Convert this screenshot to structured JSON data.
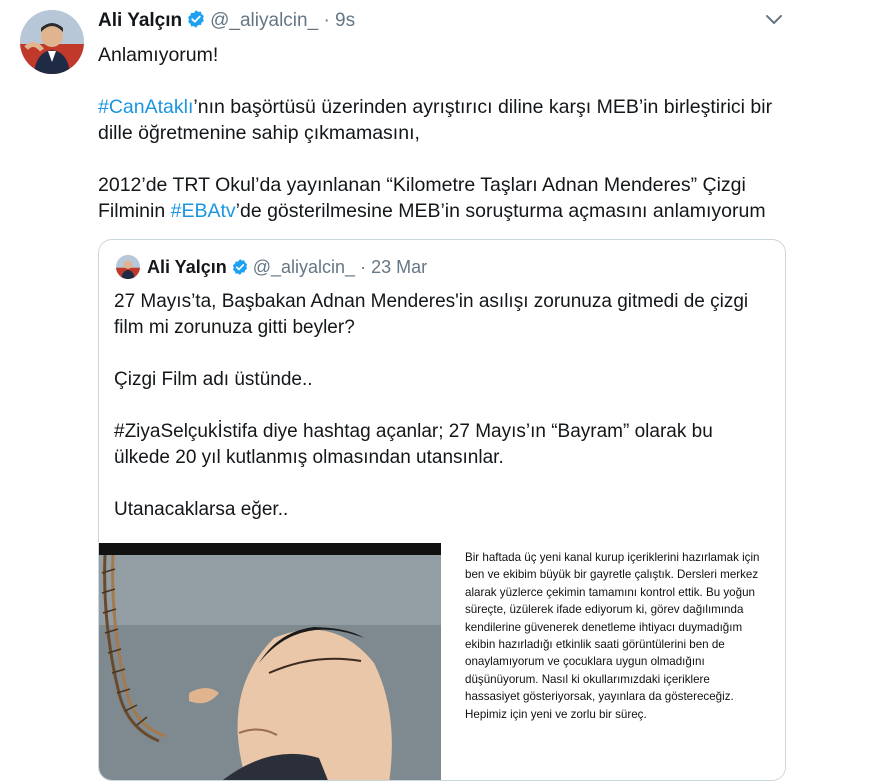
{
  "tweet": {
    "author_name": "Ali Yalçın",
    "author_handle": "@_aliyalcin_",
    "separator": "·",
    "time": "9s",
    "paragraphs": [
      [
        {
          "t": "Anlamıyorum!",
          "h": false
        }
      ],
      [
        {
          "t": "#CanAtaklı",
          "h": true
        },
        {
          "t": "’nın başörtüsü üzerinden ayrıştırıcı diline karşı MEB’in birleştirici bir dille öğretmenine sahip çıkmamasını,",
          "h": false
        }
      ],
      [
        {
          "t": "2012’de TRT Okul’da yayınlanan “Kilometre Taşları Adnan Menderes” Çizgi Filminin ",
          "h": false
        },
        {
          "t": "#EBAtv",
          "h": true
        },
        {
          "t": "’de gösterilmesine MEB’in soruşturma açmasını anlamıyorum",
          "h": false
        }
      ]
    ]
  },
  "quoted": {
    "author_name": "Ali Yalçın",
    "author_handle": "@_aliyalcin_",
    "separator": "·",
    "time": "23 Mar",
    "paragraphs": [
      "27 Mayıs’ta, Başbakan Adnan Menderes'in asılışı zorunuza gitmedi de çizgi film mi zorunuza gitti beyler?",
      "Çizgi Film adı üstünde..",
      "#ZiyaSelçukİstifa diye hashtag açanlar; 27 Mayıs’ın “Bayram” olarak bu ülkede 20 yıl kutlanmış olmasından utansınlar.",
      "Utanacaklarsa eğer.."
    ],
    "statement_text": "Bir haftada üç yeni kanal kurup içeriklerini hazırlamak için ben ve ekibim büyük bir gayretle çalıştık. Dersleri merkez alarak yüzlerce çekimin tamamını kontrol ettik. Bu yoğun süreçte, üzülerek ifade ediyorum ki, görev dağılımında kendilerine güvenerek denetleme ihtiyacı duymadığım ekibin hazırladığı etkinlik saati görüntülerini ben de onaylamıyorum ve çocuklara uygun olmadığını düşünüyorum. Nasıl ki okullarımızdaki içeriklere hassasiyet gösteriyorsak, yayınlara da göstereceğiz. Hepimiz için yeni ve zorlu bir süreç."
  },
  "icons": {
    "verified": "verified-badge-icon",
    "caret": "chevron-down-icon"
  },
  "colors": {
    "link": "#1b95e0",
    "muted": "#657786",
    "text": "#14171a",
    "border": "#ccd6dd",
    "verified": "#1da1f2"
  }
}
